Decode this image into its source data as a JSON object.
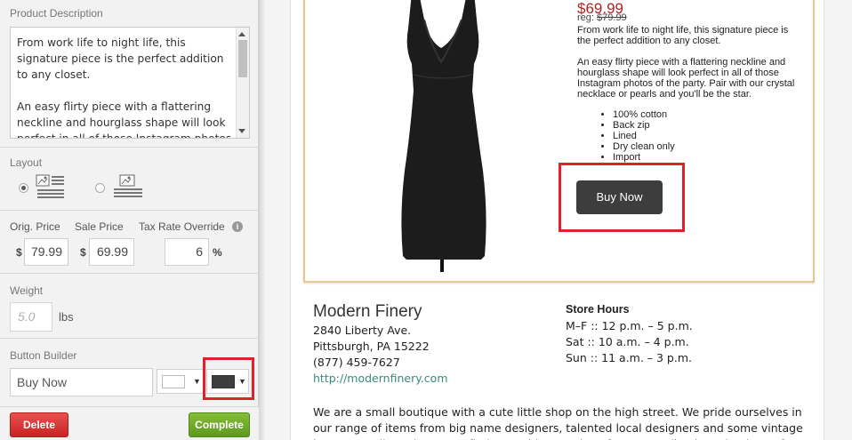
{
  "editor": {
    "description": {
      "title": "Product Description",
      "paragraphs": [
        "From work life to night life, this signature piece is the perfect addition to any closet.",
        "An easy flirty piece with a flattering neckline and hourglass shape will look perfect in all of those Instagram photos"
      ]
    },
    "layout": {
      "title": "Layout",
      "options": [
        "image-left-text-right-icon",
        "image-top-text-below-icon"
      ],
      "selected_index": 0
    },
    "pricing": {
      "orig_label": "Orig. Price",
      "sale_label": "Sale Price",
      "tax_label": "Tax Rate Override",
      "currency_symbol": "$",
      "orig_value": "79.99",
      "sale_value": "69.99",
      "tax_value": "6",
      "percent_symbol": "%"
    },
    "weight": {
      "title": "Weight",
      "placeholder": "5.0",
      "unit": "lbs"
    },
    "button_builder": {
      "title": "Button Builder",
      "text_value": "Buy Now",
      "text_color": "#ffffff",
      "bg_color": "#3d3d3d",
      "caret": "▼"
    },
    "actions": {
      "delete_label": "Delete",
      "complete_label": "Complete"
    },
    "info_symbol": "i"
  },
  "preview": {
    "price": "$69.99",
    "reg_prefix": "reg:",
    "reg_price": "$79.99",
    "paragraphs": [
      "From work life to night life, this signature piece is the perfect addition to any closet.",
      "An easy flirty piece with a flattering neckline and hourglass shape will look perfect in all of those Instagram photos of the party.  Pair with our crystal necklace or pearls and you'll be the star."
    ],
    "features": [
      "100% cotton",
      "Back zip",
      "Lined",
      "Dry clean only",
      "Import"
    ],
    "buy_button_label": "Buy Now",
    "store": {
      "name": "Modern Finery",
      "address1": "2840 Liberty Ave.",
      "address2": "Pittsburgh, PA 15222",
      "phone": "(877) 459-7627",
      "website": "http://modernfinery.com"
    },
    "hours": {
      "title": "Store Hours",
      "lines": [
        "M–F :: 12 p.m. – 5 p.m.",
        "Sat :: 10 a.m. – 4 p.m.",
        "Sun :: 11 a.m. – 3 p.m."
      ]
    },
    "about": "We are a small boutique with a cute little shop on the high street. We pride ourselves in our range of items from big name designers, talented local designers and some vintage items as well. We hope you find something you love from our collection. Thank you for"
  }
}
